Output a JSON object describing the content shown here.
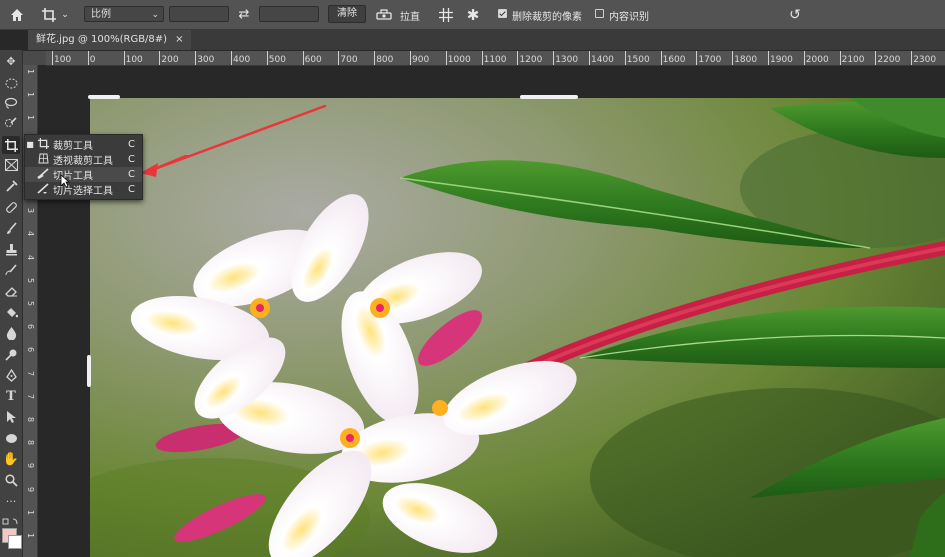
{
  "options_bar": {
    "home_icon": "home-icon",
    "crop_icon": "crop-icon",
    "ratio_select": "比例",
    "swap_icon": "swap-icon",
    "clear_label": "清除",
    "straighten_icon": "level-icon",
    "straighten_label": "拉直",
    "grid_icon": "grid-overlay-icon",
    "settings_icon": "gear-icon",
    "delete_cropped_label": "删除裁剪的像素",
    "delete_cropped_checked": true,
    "content_aware_label": "内容识别",
    "content_aware_checked": false,
    "reset_icon": "undo-icon"
  },
  "document_tab": {
    "title": "鲜花.jpg @ 100%(RGB/8#)",
    "close_label": "×"
  },
  "ruler": {
    "h_ticks": [
      "100",
      "0",
      "100",
      "200",
      "300",
      "400",
      "500",
      "600",
      "700",
      "800",
      "900",
      "1000",
      "1100",
      "1200",
      "1300",
      "1400",
      "1500",
      "1600",
      "1700",
      "1800",
      "1900",
      "2000",
      "2100",
      "2200",
      "2300"
    ],
    "v_ticks": [
      "1",
      "1",
      "1",
      "2",
      "2",
      "3",
      "3",
      "4",
      "4",
      "5",
      "5",
      "6",
      "6",
      "7",
      "7",
      "8",
      "8",
      "9",
      "9",
      "1",
      "1"
    ]
  },
  "crop_flyout": {
    "items": [
      {
        "label": "裁剪工具",
        "key": "C",
        "icon": "crop-icon",
        "selected": true
      },
      {
        "label": "透视裁剪工具",
        "key": "C",
        "icon": "perspective-crop-icon",
        "selected": false
      },
      {
        "label": "切片工具",
        "key": "C",
        "icon": "slice-icon",
        "selected": false
      },
      {
        "label": "切片选择工具",
        "key": "C",
        "icon": "slice-select-icon",
        "selected": false
      }
    ]
  },
  "colors": {
    "accent_arrow": "#e8373a",
    "panel_bg": "#535353"
  }
}
